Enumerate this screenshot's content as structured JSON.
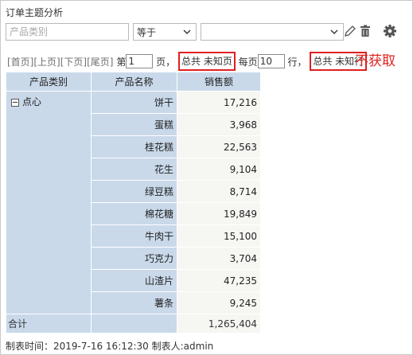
{
  "title": "订单主题分析",
  "filter": {
    "field_placeholder": "产品类别",
    "operator": "等于",
    "value": ""
  },
  "pager": {
    "first": "[首页]",
    "prev": "[上页]",
    "next": "[下页]",
    "last": "[尾页]",
    "page_prefix": "第",
    "page_value": "1",
    "page_suffix": "页，",
    "total_pages": "总共 未知页",
    "per_page_label": "每页",
    "per_page_value": "10",
    "rows_suffix": "行，",
    "total_rows": "总共 未知行",
    "annotation": "不获取"
  },
  "table": {
    "headers": [
      "产品类别",
      "产品名称",
      "销售额"
    ],
    "category": "点心",
    "rows": [
      {
        "name": "饼干",
        "sales": "17,216"
      },
      {
        "name": "蛋糕",
        "sales": "3,968"
      },
      {
        "name": "桂花糕",
        "sales": "22,563"
      },
      {
        "name": "花生",
        "sales": "9,104"
      },
      {
        "name": "绿豆糕",
        "sales": "8,714"
      },
      {
        "name": "棉花糖",
        "sales": "19,849"
      },
      {
        "name": "牛肉干",
        "sales": "15,100"
      },
      {
        "name": "巧克力",
        "sales": "3,704"
      },
      {
        "name": "山渣片",
        "sales": "47,235"
      },
      {
        "name": "薯条",
        "sales": "9,245"
      }
    ],
    "total_label": "合计",
    "total_value": "1,265,404"
  },
  "footer": "制表时间：2019-7-16 16:12:30 制表人:admin"
}
